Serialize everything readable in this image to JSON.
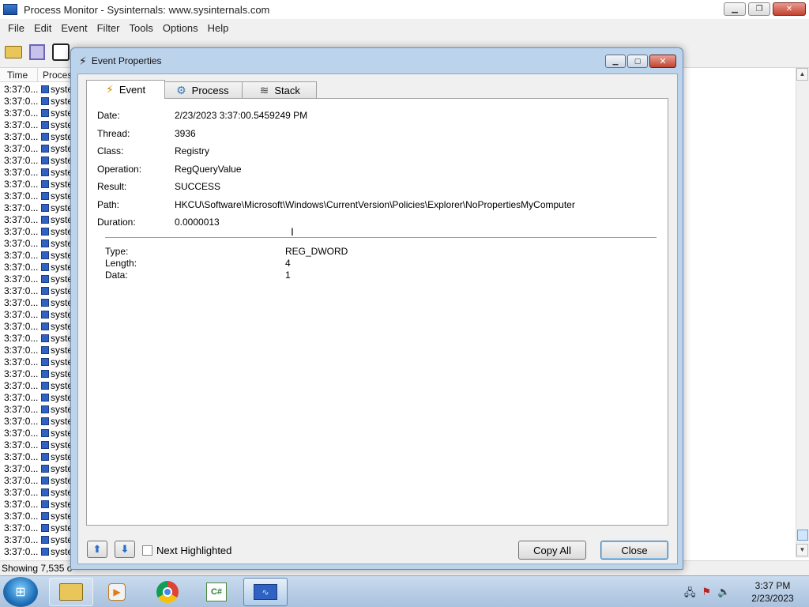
{
  "main_window": {
    "title": "Process Monitor - Sysinternals: www.sysinternals.com",
    "menu": [
      "File",
      "Edit",
      "Event",
      "Filter",
      "Tools",
      "Options",
      "Help"
    ],
    "columns": [
      "Time ...",
      "Proces"
    ],
    "rows": {
      "time": "3:37:0...",
      "process": "syste",
      "count": 40
    },
    "status_text": "Showing 7,535 o"
  },
  "dialog": {
    "title": "Event Properties",
    "tabs": [
      {
        "label": "Event",
        "icon": "lightning-icon",
        "active": true
      },
      {
        "label": "Process",
        "icon": "gear-icon",
        "active": false
      },
      {
        "label": "Stack",
        "icon": "stack-icon",
        "active": false
      }
    ],
    "fields": {
      "date": {
        "label": "Date:",
        "value": "2/23/2023 3:37:00.5459249 PM"
      },
      "thread": {
        "label": "Thread:",
        "value": "3936"
      },
      "class": {
        "label": "Class:",
        "value": "Registry"
      },
      "operation": {
        "label": "Operation:",
        "value": "RegQueryValue"
      },
      "result": {
        "label": "Result:",
        "value": "SUCCESS"
      },
      "path": {
        "label": "Path:",
        "value": "HKCU\\Software\\Microsoft\\Windows\\CurrentVersion\\Policies\\Explorer\\NoPropertiesMyComputer"
      },
      "duration": {
        "label": "Duration:",
        "value": "0.0000013"
      }
    },
    "details": {
      "type": {
        "label": "Type:",
        "value": "REG_DWORD"
      },
      "length": {
        "label": "Length:",
        "value": "4"
      },
      "data": {
        "label": "Data:",
        "value": "1"
      }
    },
    "next_highlighted_label": "Next Highlighted",
    "next_highlighted_checked": false,
    "copy_all_label": "Copy All",
    "close_label": "Close"
  },
  "taskbar": {
    "apps": [
      "explorer-icon",
      "media-player-icon",
      "chrome-icon",
      "csharp-icon",
      "process-monitor-icon"
    ],
    "clock_time": "3:37 PM",
    "clock_date": "2/23/2023"
  }
}
